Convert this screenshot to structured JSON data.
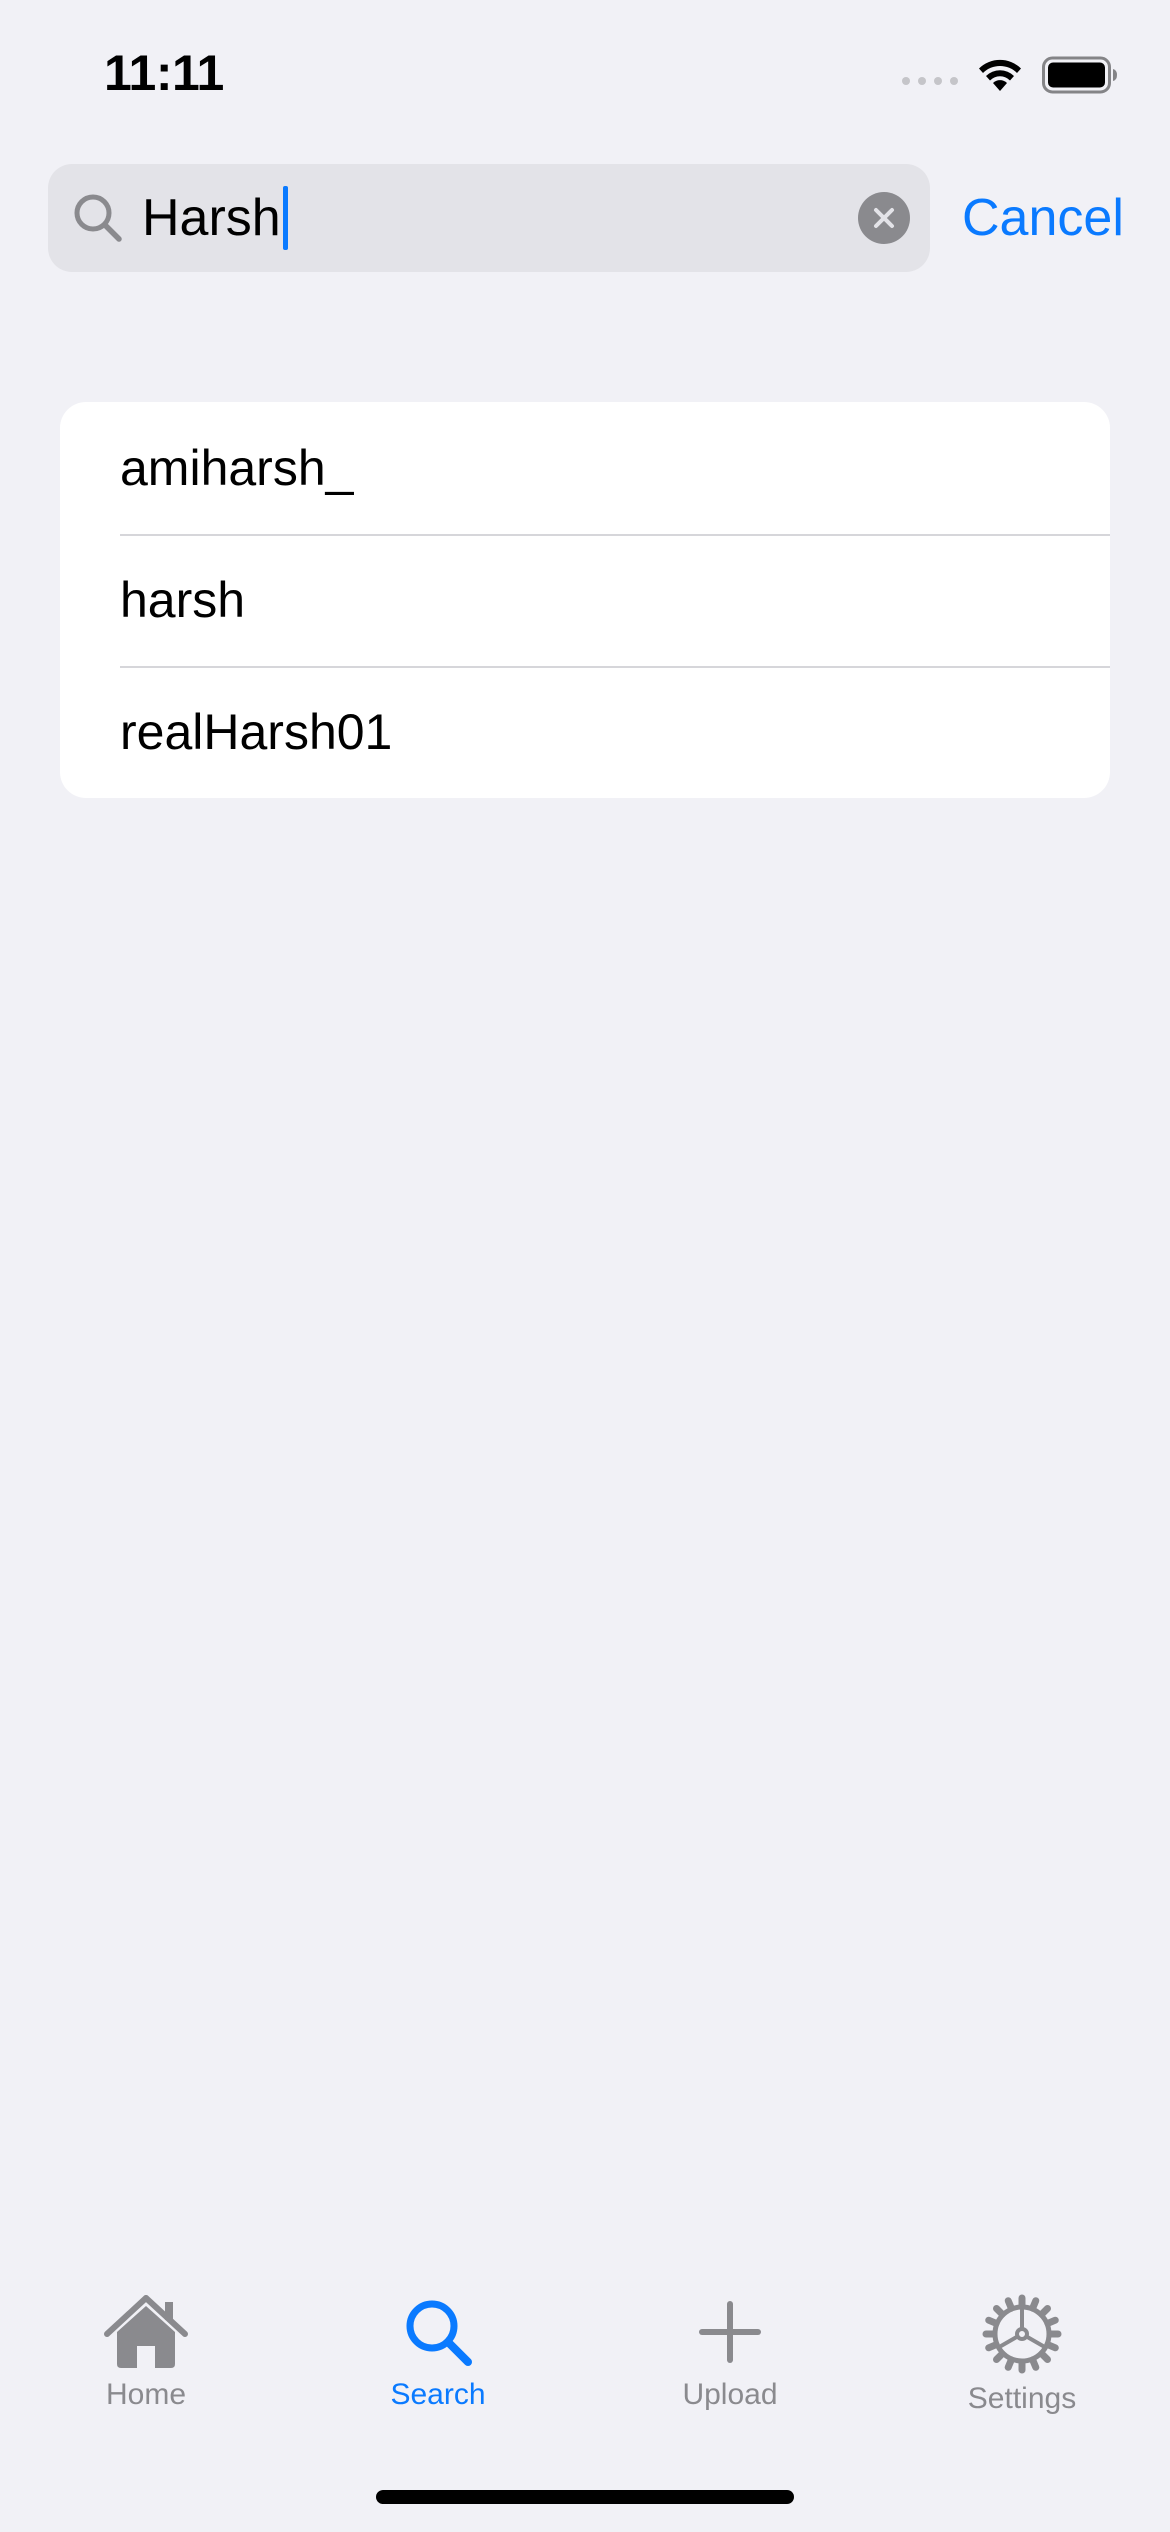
{
  "status_bar": {
    "time": "11:11"
  },
  "search": {
    "query": "Harsh",
    "cancel_label": "Cancel"
  },
  "results": [
    {
      "label": "amiharsh_"
    },
    {
      "label": "harsh"
    },
    {
      "label": "realHarsh01"
    }
  ],
  "tab_bar": {
    "tabs": [
      {
        "label": "Home",
        "icon": "house-icon",
        "active": false
      },
      {
        "label": "Search",
        "icon": "magnifyingglass-icon",
        "active": true
      },
      {
        "label": "Upload",
        "icon": "plus-icon",
        "active": false
      },
      {
        "label": "Settings",
        "icon": "gear-icon",
        "active": false
      }
    ]
  },
  "colors": {
    "accent": "#0A7AFF",
    "background": "#F1F1F6",
    "inactive": "#8A8A8E"
  }
}
